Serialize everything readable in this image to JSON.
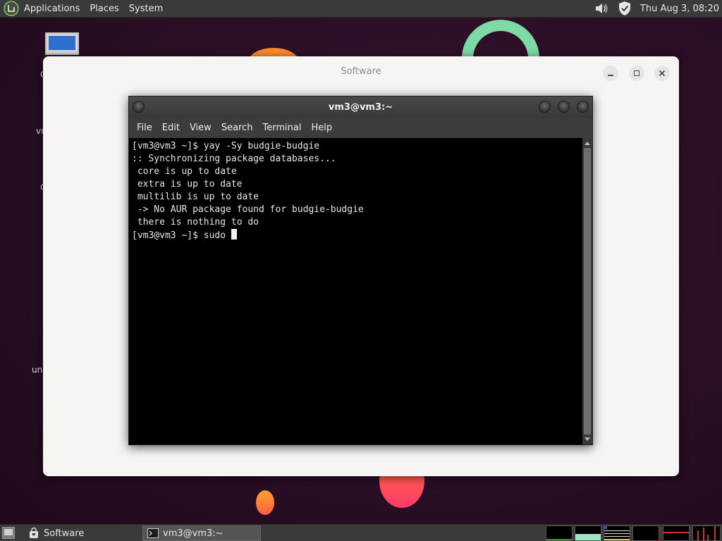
{
  "top_panel": {
    "menus": [
      "Applications",
      "Places",
      "System"
    ],
    "clock": "Thu Aug  3, 08:20",
    "icons": [
      "mint-logo-icon",
      "volume-icon",
      "shield-icon"
    ]
  },
  "desktop": {
    "icon_labels": [
      "C",
      "vm",
      "C",
      "un"
    ]
  },
  "software_window": {
    "title": "Software",
    "controls": [
      "minimize",
      "maximize",
      "close"
    ]
  },
  "terminal": {
    "title": "vm3@vm3:~",
    "menu": [
      "File",
      "Edit",
      "View",
      "Search",
      "Terminal",
      "Help"
    ],
    "lines": [
      "[vm3@vm3 ~]$ yay -Sy budgie-budgie",
      ":: Synchronizing package databases...",
      " core is up to date",
      " extra is up to date",
      " multilib is up to date",
      " -> No AUR package found for budgie-budgie",
      " there is nothing to do"
    ],
    "prompt": "[vm3@vm3 ~]$ sudo "
  },
  "taskbar": {
    "items": [
      {
        "label": "Software",
        "active": false
      },
      {
        "label": "vm3@vm3:~",
        "active": true
      }
    ]
  },
  "colors": {
    "panel": "#3a3a3a",
    "desktop": "#2a0f24",
    "terminal_bg": "#000000",
    "accent_green": "#7ed4a8",
    "accent_orange": "#ff7b2e"
  }
}
